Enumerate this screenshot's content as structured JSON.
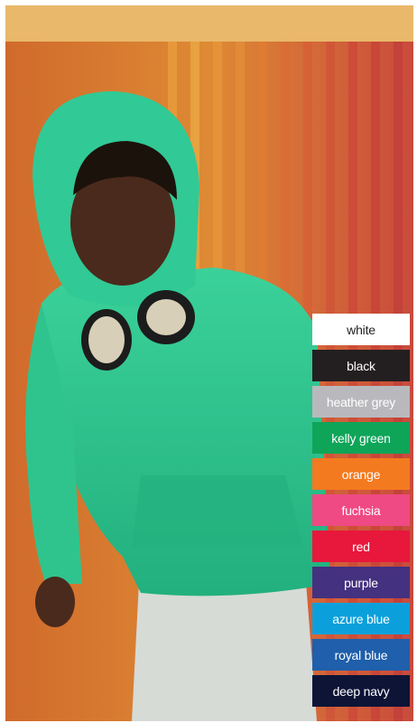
{
  "colors": [
    {
      "name": "white",
      "bg": "#ffffff",
      "fg": "#222222"
    },
    {
      "name": "black",
      "bg": "#231f20",
      "fg": "#ffffff"
    },
    {
      "name": "heather grey",
      "bg": "#b9b9bd",
      "fg": "#ffffff"
    },
    {
      "name": "kelly green",
      "bg": "#0ea559",
      "fg": "#ffffff"
    },
    {
      "name": "orange",
      "bg": "#f47a20",
      "fg": "#ffffff"
    },
    {
      "name": "fuchsia",
      "bg": "#ef4a83",
      "fg": "#ffffff"
    },
    {
      "name": "red",
      "bg": "#e8173c",
      "fg": "#ffffff"
    },
    {
      "name": "purple",
      "bg": "#44317f",
      "fg": "#ffffff"
    },
    {
      "name": "azure blue",
      "bg": "#0ba0dc",
      "fg": "#ffffff"
    },
    {
      "name": "royal blue",
      "bg": "#1f5fab",
      "fg": "#ffffff"
    },
    {
      "name": "deep navy",
      "bg": "#0d1436",
      "fg": "#ffffff"
    }
  ]
}
